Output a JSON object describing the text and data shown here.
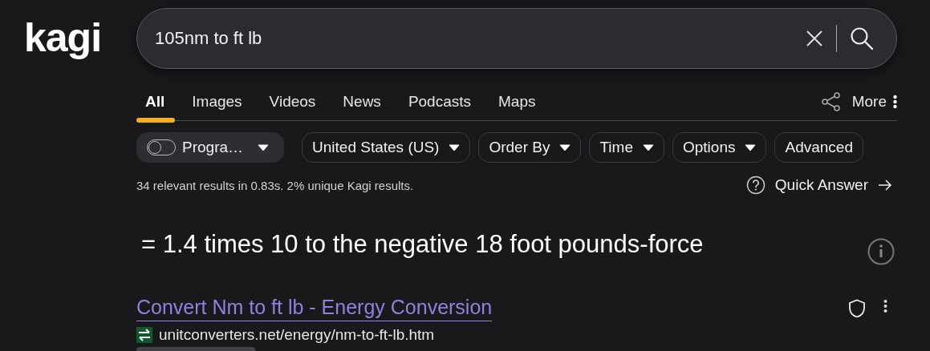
{
  "logo": {
    "text": "kagi"
  },
  "search": {
    "value": "105nm to ft lb"
  },
  "tabs": [
    {
      "label": "All",
      "selected": true
    },
    {
      "label": "Images",
      "selected": false
    },
    {
      "label": "Videos",
      "selected": false
    },
    {
      "label": "News",
      "selected": false
    },
    {
      "label": "Podcasts",
      "selected": false
    },
    {
      "label": "Maps",
      "selected": false
    }
  ],
  "more": {
    "label": "More"
  },
  "filters": [
    {
      "kind": "toggle",
      "label": "Progra…",
      "on": false
    },
    {
      "kind": "dropdown",
      "label": "United States (US)"
    },
    {
      "kind": "dropdown",
      "label": "Order By"
    },
    {
      "kind": "dropdown",
      "label": "Time"
    },
    {
      "kind": "dropdown",
      "label": "Options"
    },
    {
      "kind": "plain",
      "label": "Advanced"
    }
  ],
  "stats": "34 relevant results in 0.83s. 2% unique Kagi results.",
  "quick_answer": {
    "label": "Quick Answer"
  },
  "answer": "= 1.4 times 10 to the negative 18 foot pounds-force",
  "results": [
    {
      "title": "Convert Nm to ft lb - Energy Conversion",
      "url": "unitconverters.net/energy/nm-to-ft-lb.htm"
    }
  ]
}
